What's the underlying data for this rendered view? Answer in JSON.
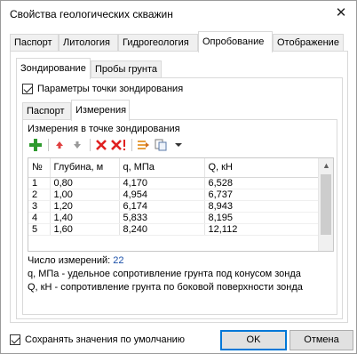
{
  "window": {
    "title": "Свойства геологических скважин",
    "close_symbol": "✕"
  },
  "top_tabs": [
    "Паспорт",
    "Литология",
    "Гидрогеология",
    "Опробование",
    "Отображение"
  ],
  "second_tabs": [
    "Зондирование",
    "Пробы грунта"
  ],
  "params_checkbox": {
    "label": "Параметры точки зондирования",
    "checked": true
  },
  "third_tabs": [
    "Паспорт",
    "Измерения"
  ],
  "group_title": "Измерения в точке зондирования",
  "toolbar": {
    "icons": [
      "add-icon",
      "move-up-icon",
      "move-down-icon",
      "delete-icon",
      "delete-all-icon",
      "import-icon",
      "paste-icon",
      "dropdown-icon"
    ]
  },
  "table": {
    "columns": [
      "№",
      "Глубина, м",
      "q, МПа",
      "Q, кН"
    ],
    "rows": [
      [
        "1",
        "0,80",
        "4,170",
        "6,528"
      ],
      [
        "2",
        "1,00",
        "4,954",
        "6,737"
      ],
      [
        "3",
        "1,20",
        "6,174",
        "8,943"
      ],
      [
        "4",
        "1,40",
        "5,833",
        "8,195"
      ],
      [
        "5",
        "1,60",
        "8,240",
        "12,112"
      ]
    ]
  },
  "count": {
    "label": "Число измерений: ",
    "value": "22"
  },
  "notes": {
    "q": "q, МПа - удельное сопротивление грунта под конусом зонда",
    "Q": "Q, кН - сопротивление грунта по боковой поверхности зонда"
  },
  "save_default": {
    "label": "Сохранять значения по умолчанию",
    "checked": true
  },
  "buttons": {
    "ok": "OK",
    "cancel": "Отмена"
  },
  "colors": {
    "accent": "#0078d7",
    "add_green": "#2e9a2e",
    "delete_red": "#e02020",
    "count_blue": "#1a4fa8"
  }
}
